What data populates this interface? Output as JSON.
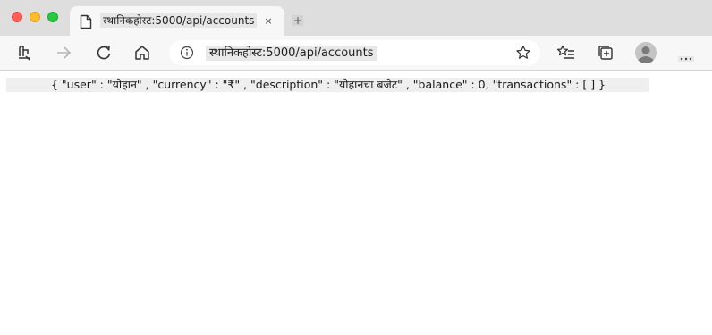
{
  "window": {
    "traffic_lights": [
      "close",
      "minimize",
      "maximize"
    ]
  },
  "tab": {
    "title": "स्थानिकहोस्ट:5000/api/accounts",
    "close_label": "×",
    "favicon": "page-icon"
  },
  "newtab": {
    "label": "+"
  },
  "toolbar": {
    "icons": [
      "reading-mode-icon",
      "back-icon",
      "forward-icon",
      "refresh-icon",
      "home-icon",
      "info-icon",
      "star-icon",
      "favorites-icon",
      "collections-icon",
      "avatar-icon",
      "more-icon"
    ]
  },
  "address_bar": {
    "url": "स्थानिकहोस्ट:5000/api/accounts"
  },
  "page": {
    "json_text": "{ \"user\" : \"योहान\" , \"currency\" : \"₹\" , \"description\" : \"योहानचा बजेट\" , \"balance\" : 0, \"transactions\" : [ ] }"
  },
  "colors": {
    "tabstrip": "#dedede",
    "toolbar": "#f7f7f7",
    "close": "#fe5f57",
    "minimize": "#febc2e",
    "maximize": "#28c840"
  }
}
